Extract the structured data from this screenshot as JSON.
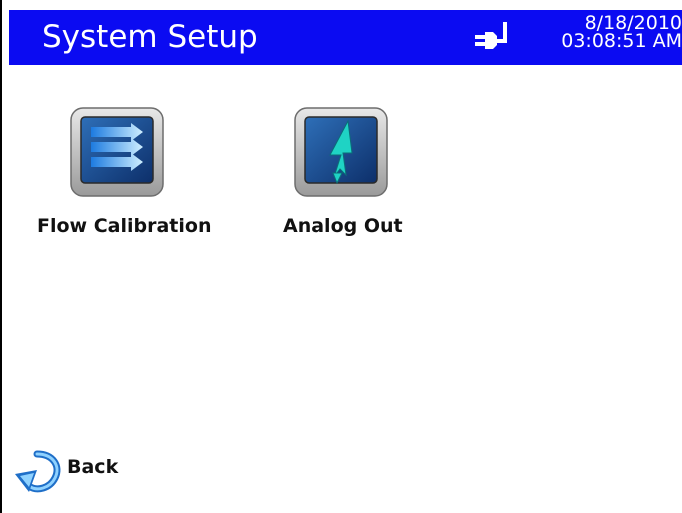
{
  "header": {
    "title": "System Setup",
    "date": "8/18/2010",
    "time": "03:08:51 AM",
    "background": "#0b0bf2",
    "status_icon": "plug-icon"
  },
  "tiles": [
    {
      "label": "Flow Calibration",
      "icon": "flow-arrows-icon"
    },
    {
      "label": "Analog Out",
      "icon": "lightning-icon"
    }
  ],
  "back": {
    "label": "Back",
    "icon": "back-arrow-icon"
  }
}
